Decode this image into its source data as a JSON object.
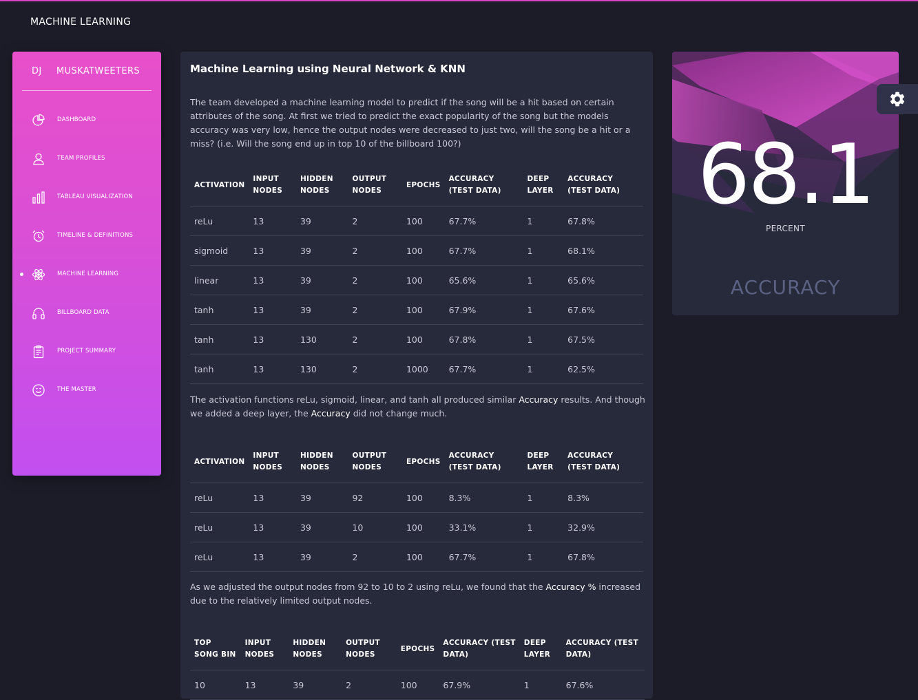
{
  "app": {
    "title": "MACHINE LEARNING"
  },
  "sidebar": {
    "abbr": "DJ",
    "name": "MUSKATWEETERS",
    "items": [
      {
        "label": "DASHBOARD",
        "icon": "pie-chart-icon"
      },
      {
        "label": "TEAM PROFILES",
        "icon": "user-icon"
      },
      {
        "label": "TABLEAU VISUALIZATION",
        "icon": "bar-chart-icon"
      },
      {
        "label": "TIMELINE & DEFINITIONS",
        "icon": "alarm-clock-icon"
      },
      {
        "label": "MACHINE LEARNING",
        "icon": "atom-icon",
        "active": true
      },
      {
        "label": "BILLBOARD DATA",
        "icon": "headphones-icon"
      },
      {
        "label": "PROJECT SUMMARY",
        "icon": "clipboard-icon"
      },
      {
        "label": "THE MASTER",
        "icon": "smile-icon"
      }
    ]
  },
  "main": {
    "title": "Machine Learning using Neural Network & KNN",
    "intro": "The team developed a machine learning model to predict if the song will be a hit based on certain attributes of the song. At first we tried to predict the exact popularity of the song but the models accuracy was very low, hence the output nodes were decreased to just two, will the song be a hit or a miss? (i.e. Will the song end up in top 10 of the billboard 100?)",
    "table1": {
      "headers": [
        "ACTIVATION",
        "INPUT NODES",
        "HIDDEN NODES",
        "OUTPUT NODES",
        "EPOCHS",
        "ACCURACY (TEST DATA)",
        "DEEP LAYER",
        "ACCURACY (TEST DATA)"
      ],
      "rows": [
        [
          "reLu",
          "13",
          "39",
          "2",
          "100",
          "67.7%",
          "1",
          "67.8%"
        ],
        [
          "sigmoid",
          "13",
          "39",
          "2",
          "100",
          "67.7%",
          "1",
          "68.1%"
        ],
        [
          "linear",
          "13",
          "39",
          "2",
          "100",
          "65.6%",
          "1",
          "65.6%"
        ],
        [
          "tanh",
          "13",
          "39",
          "2",
          "100",
          "67.9%",
          "1",
          "67.6%"
        ],
        [
          "tanh",
          "13",
          "130",
          "2",
          "100",
          "67.8%",
          "1",
          "67.5%"
        ],
        [
          "tanh",
          "13",
          "130",
          "2",
          "1000",
          "67.7%",
          "1",
          "62.5%"
        ]
      ]
    },
    "para2": {
      "part1": "The activation functions reLu, sigmoid, linear, and tanh all produced similar ",
      "em1": "Accuracy",
      "part2": " results. And though we added a deep layer, the ",
      "em2": "Accuracy",
      "part3": " did not change much."
    },
    "table2": {
      "headers": [
        "ACTIVATION",
        "INPUT NODES",
        "HIDDEN NODES",
        "OUTPUT NODES",
        "EPOCHS",
        "ACCURACY (TEST DATA)",
        "DEEP LAYER",
        "ACCURACY (TEST DATA)"
      ],
      "rows": [
        [
          "reLu",
          "13",
          "39",
          "92",
          "100",
          "8.3%",
          "1",
          "8.3%"
        ],
        [
          "reLu",
          "13",
          "39",
          "10",
          "100",
          "33.1%",
          "1",
          "32.9%"
        ],
        [
          "reLu",
          "13",
          "39",
          "2",
          "100",
          "67.7%",
          "1",
          "67.8%"
        ]
      ]
    },
    "para3": {
      "part1": "As we adjusted the output nodes from 92 to 10 to 2 using reLu, we found that the ",
      "em1": "Accuracy %",
      "part2": " increased due to the relatively limited output nodes."
    },
    "table3": {
      "headers": [
        "TOP SONG BIN",
        "INPUT NODES",
        "HIDDEN NODES",
        "OUTPUT NODES",
        "EPOCHS",
        "ACCURACY (TEST DATA)",
        "DEEP LAYER",
        "ACCURACY (TEST DATA)"
      ],
      "rows": [
        [
          "10",
          "13",
          "39",
          "2",
          "100",
          "67.9%",
          "1",
          "67.6%"
        ]
      ]
    }
  },
  "accuracy": {
    "value": "68.1",
    "unit": "PERCENT",
    "caption": "ACCURACY"
  },
  "settings": {
    "icon": "gear-icon"
  },
  "colors": {
    "accent": "#d646c8",
    "sidebar_top": "#e84fca",
    "sidebar_bottom": "#c24ff0",
    "card": "#272a3b",
    "background": "#1b1c27"
  }
}
